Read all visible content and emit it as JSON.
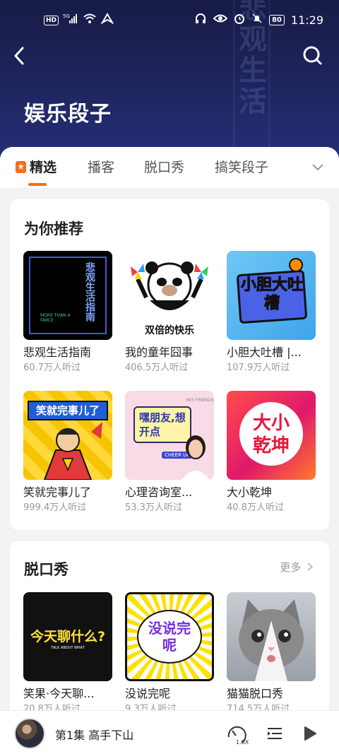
{
  "status_bar": {
    "left_icons": [
      "hd-icon",
      "signal-5g-icon",
      "wifi-icon",
      "location-icon"
    ],
    "hd_label": "HD",
    "network_label": "5G",
    "battery": "80",
    "time": "11:29"
  },
  "header": {
    "title": "娱乐段子",
    "decoration_text": "悲观生活"
  },
  "tabs": [
    {
      "label": "精选",
      "active": true
    },
    {
      "label": "播客",
      "active": false
    },
    {
      "label": "脱口秀",
      "active": false
    },
    {
      "label": "搞笑段子",
      "active": false
    }
  ],
  "sections": {
    "recommend": {
      "title": "为你推荐",
      "items": [
        {
          "title": "悲观生活指南",
          "listens": "60.7万人听过",
          "cover_text": "悲观生活指南",
          "cover_sub": "MORE THAN A FARCE"
        },
        {
          "title": "我的童年囧事",
          "listens": "406.5万人听过",
          "cover_text": "双倍的快乐"
        },
        {
          "title": "小胆大吐槽 |...",
          "listens": "107.9万人听过",
          "cover_text": "小胆大吐槽"
        },
        {
          "title": "笑就完事儿了",
          "listens": "999.4万人听过",
          "cover_text": "笑就完事儿了"
        },
        {
          "title": "心理咨询室...",
          "listens": "53.3万人听过",
          "cover_text": "嘿朋友,想开点",
          "cover_sub": "CHEER UP",
          "cover_tag": "HEY FRIENDS"
        },
        {
          "title": "大小乾坤",
          "listens": "40.8万人听过",
          "cover_text": "大小乾坤"
        }
      ]
    },
    "talkshow": {
      "title": "脱口秀",
      "more_label": "更多",
      "items": [
        {
          "title": "笑果·今天聊...",
          "listens": "20.8万人听过",
          "cover_text": "今天聊什么?",
          "cover_sub": "TALK ABOUT WHAT"
        },
        {
          "title": "没说完呢",
          "listens": "9.3万人听过",
          "cover_text": "没说完呢"
        },
        {
          "title": "猫猫脱口秀",
          "listens": "714.5万人听过",
          "cover_text": ""
        }
      ]
    }
  },
  "player": {
    "episode_title": "第1集 高手下山",
    "speed_label": "1.0X"
  },
  "colors": {
    "accent": "#ff6a13",
    "header_bg": "#1f2660"
  }
}
